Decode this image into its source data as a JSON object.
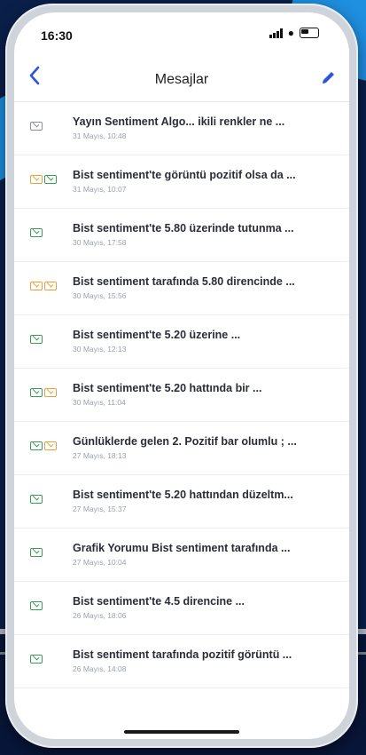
{
  "status_bar": {
    "time": "16:30"
  },
  "header": {
    "title": "Mesajlar",
    "back_icon": "chevron-left-icon",
    "edit_icon": "pencil-icon",
    "accent": "#2a56d8"
  },
  "messages": [
    {
      "title": "Yayın Sentiment Algo... ikili renkler ne ...",
      "time": "31 Mayıs, 10:48",
      "icons": [
        "gray"
      ]
    },
    {
      "title": "Bist sentiment'te görüntü pozitif olsa da ...",
      "time": "31 Mayıs, 10:07",
      "icons": [
        "orange",
        "green"
      ]
    },
    {
      "title": "Bist sentiment'te 5.80 üzerinde tutunma ...",
      "time": "30 Mayıs, 17:58",
      "icons": [
        "green"
      ]
    },
    {
      "title": "Bist sentiment tarafında 5.80 direncinde ...",
      "time": "30 Mayıs, 15:56",
      "icons": [
        "orange",
        "orange"
      ]
    },
    {
      "title": "Bist sentiment'te 5.20 üzerine ...",
      "time": "30 Mayıs, 12:13",
      "icons": [
        "green"
      ]
    },
    {
      "title": "Bist sentiment'te 5.20 hattında bir ...",
      "time": "30 Mayıs, 11:04",
      "icons": [
        "green",
        "orange"
      ]
    },
    {
      "title": "Günlüklerde gelen 2. Pozitif bar olumlu ; ...",
      "time": "27 Mayıs, 18:13",
      "icons": [
        "green",
        "orange"
      ]
    },
    {
      "title": "Bist sentiment'te 5.20 hattından düzeltm...",
      "time": "27 Mayıs, 15:37",
      "icons": [
        "green"
      ]
    },
    {
      "title": "Grafik Yorumu Bist sentiment tarafında ...",
      "time": "27 Mayıs, 10:04",
      "icons": [
        "green"
      ]
    },
    {
      "title": "Bist sentiment'te 4.5 direncine ...",
      "time": "26 Mayıs, 18:06",
      "icons": [
        "green"
      ]
    },
    {
      "title": "Bist sentiment tarafında pozitif görüntü ...",
      "time": "26 Mayıs, 14:08",
      "icons": [
        "green"
      ]
    }
  ],
  "colors": {
    "green": "#3a9a56",
    "orange": "#e8a13a",
    "gray": "#8a8f99"
  }
}
